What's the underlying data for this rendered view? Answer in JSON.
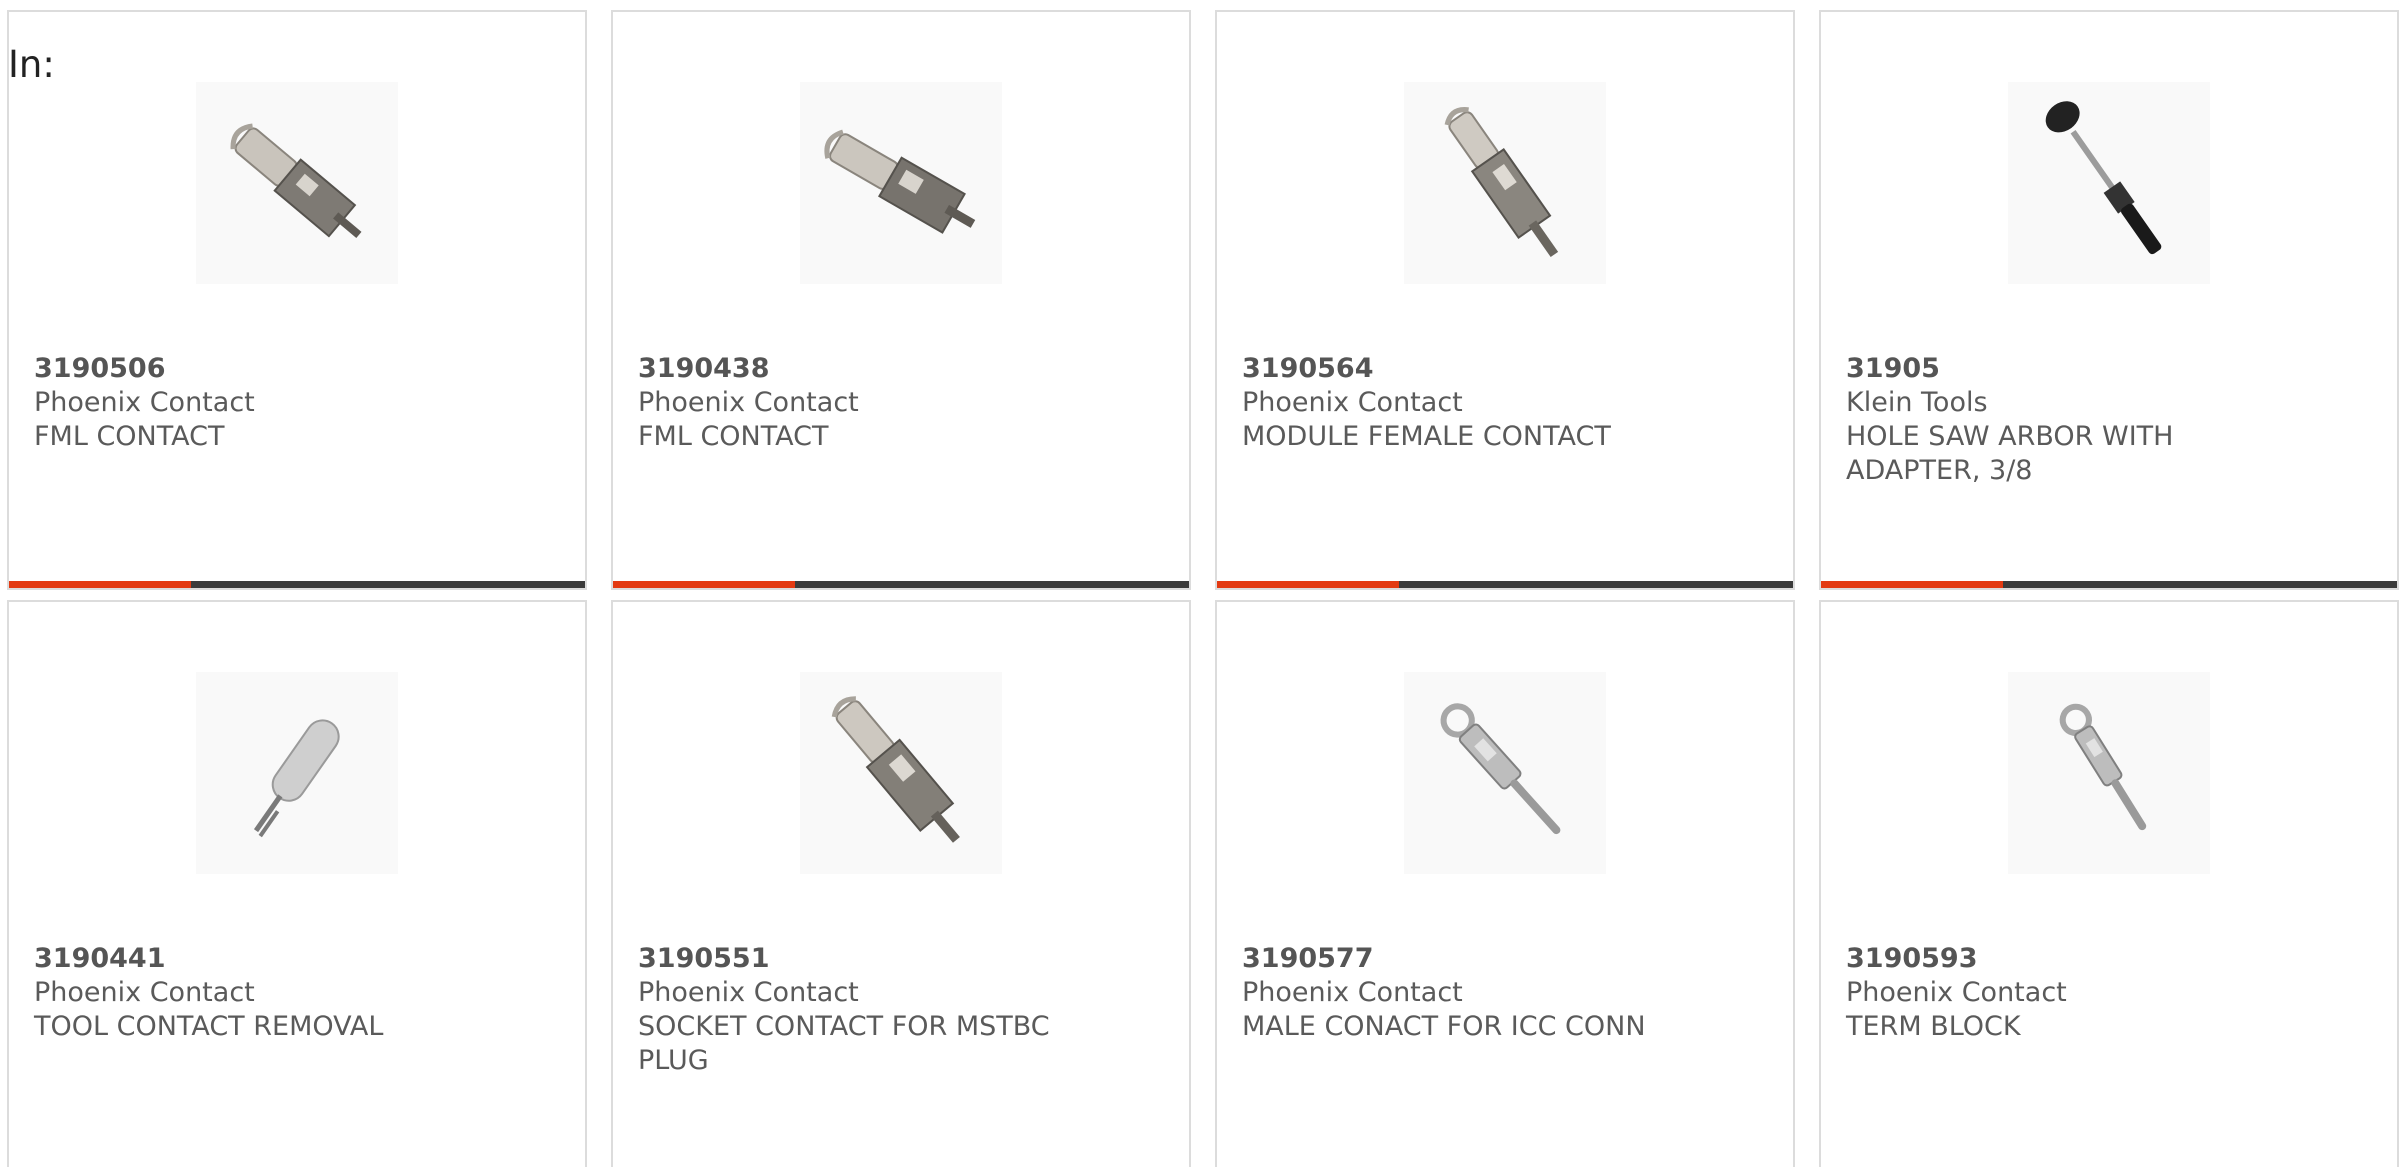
{
  "header": {
    "label": "In:"
  },
  "accent_color": "#e33a12",
  "bar_color": "#3b3b3b",
  "products": [
    {
      "part_number": "3190506",
      "manufacturer": "Phoenix Contact",
      "description": "FML CONTACT",
      "icon": "crimp-contact-icon"
    },
    {
      "part_number": "3190438",
      "manufacturer": "Phoenix Contact",
      "description": "FML CONTACT",
      "icon": "crimp-contact-icon"
    },
    {
      "part_number": "3190564",
      "manufacturer": "Phoenix Contact",
      "description": "MODULE FEMALE CONTACT",
      "icon": "female-contact-icon"
    },
    {
      "part_number": "31905",
      "manufacturer": "Klein Tools",
      "description": "HOLE SAW ARBOR WITH ADAPTER, 3/8",
      "icon": "hole-saw-arbor-icon"
    },
    {
      "part_number": "3190441",
      "manufacturer": "Phoenix Contact",
      "description": "TOOL CONTACT REMOVAL",
      "icon": "removal-tool-icon"
    },
    {
      "part_number": "3190551",
      "manufacturer": "Phoenix Contact",
      "description": "SOCKET CONTACT FOR MSTBC PLUG",
      "icon": "socket-contact-icon"
    },
    {
      "part_number": "3190577",
      "manufacturer": "Phoenix Contact",
      "description": "MALE CONACT FOR ICC CONN",
      "icon": "male-contact-icon"
    },
    {
      "part_number": "3190593",
      "manufacturer": "Phoenix Contact",
      "description": "TERM BLOCK",
      "icon": "term-block-pin-icon"
    }
  ]
}
